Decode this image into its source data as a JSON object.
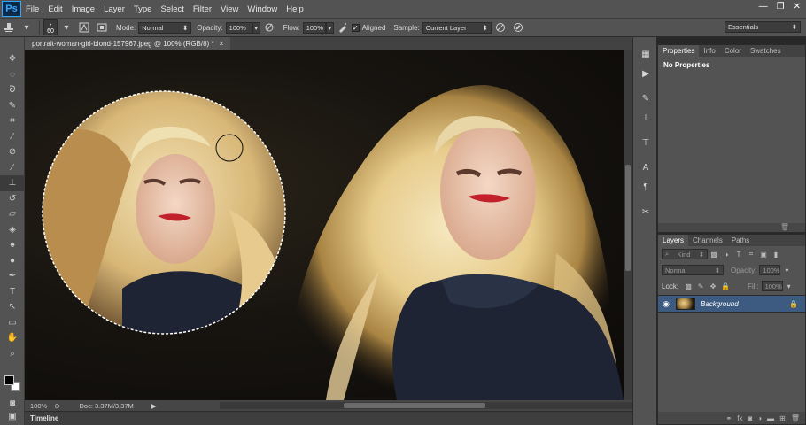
{
  "app": {
    "logo": "Ps",
    "window_controls": [
      "—",
      "❐",
      "✕"
    ]
  },
  "menu": [
    "File",
    "Edit",
    "Image",
    "Layer",
    "Type",
    "Select",
    "Filter",
    "View",
    "Window",
    "Help"
  ],
  "options": {
    "brush_size": "60",
    "mode_label": "Mode:",
    "mode_value": "Normal",
    "opacity_label": "Opacity:",
    "opacity_value": "100%",
    "flow_label": "Flow:",
    "flow_value": "100%",
    "aligned_label": "Aligned",
    "sample_label": "Sample:",
    "sample_value": "Current Layer",
    "workspace": "Essentials"
  },
  "document": {
    "tab_title": "portrait-woman-girl-blond-157967.jpeg @ 100% (RGB/8) *",
    "close": "×",
    "zoom": "100%",
    "doc_size": "Doc: 3.37M/3.37M",
    "timeline": "Timeline"
  },
  "properties_panel": {
    "tabs": [
      "Properties",
      "Info",
      "Color",
      "Swatches"
    ],
    "content": "No Properties"
  },
  "layers_panel": {
    "tabs": [
      "Layers",
      "Channels",
      "Paths"
    ],
    "kind_label": "Kind",
    "blend_mode": "Normal",
    "opacity_label": "Opacity:",
    "opacity_value": "100%",
    "lock_label": "Lock:",
    "fill_label": "Fill:",
    "fill_value": "100%",
    "layer_name": "Background"
  },
  "colors": {
    "foreground": "#000000",
    "background": "#ffffff",
    "selected_layer": "#3d5b80"
  }
}
